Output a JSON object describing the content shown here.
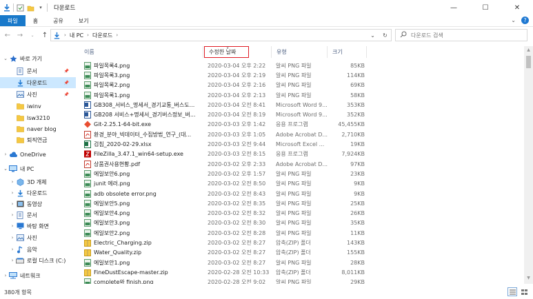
{
  "window": {
    "title": "다운로드",
    "controls": [
      "minimize",
      "maximize",
      "close"
    ]
  },
  "ribbon": {
    "tabs": [
      "파일",
      "홈",
      "공유",
      "보기"
    ]
  },
  "address": {
    "crumbs": [
      "내 PC",
      "다운로드"
    ],
    "search_placeholder": "다운로드 검색"
  },
  "nav": {
    "items": [
      {
        "label": "바로 가기",
        "icon": "star-icon",
        "level": 0,
        "expanded": true
      },
      {
        "label": "문서",
        "icon": "document-icon",
        "level": 1,
        "pinned": true
      },
      {
        "label": "다운로드",
        "icon": "download-icon",
        "level": 1,
        "pinned": true,
        "selected": true
      },
      {
        "label": "사진",
        "icon": "picture-icon",
        "level": 1,
        "pinned": true
      },
      {
        "label": "iwinv",
        "icon": "folder-icon",
        "level": 1
      },
      {
        "label": "lsw3210",
        "icon": "folder-icon",
        "level": 1
      },
      {
        "label": "naver blog",
        "icon": "folder-icon",
        "level": 1
      },
      {
        "label": "퇴직연금",
        "icon": "folder-icon",
        "level": 1
      },
      {
        "label": "OneDrive",
        "icon": "cloud-icon",
        "level": 0
      },
      {
        "label": "내 PC",
        "icon": "pc-icon",
        "level": 0,
        "expanded": true
      },
      {
        "label": "3D 개체",
        "icon": "cube-icon",
        "level": 1
      },
      {
        "label": "다운로드",
        "icon": "download-icon",
        "level": 1
      },
      {
        "label": "동영상",
        "icon": "video-icon",
        "level": 1
      },
      {
        "label": "문서",
        "icon": "document-icon",
        "level": 1
      },
      {
        "label": "바탕 화면",
        "icon": "desktop-icon",
        "level": 1
      },
      {
        "label": "사진",
        "icon": "picture-icon",
        "level": 1
      },
      {
        "label": "음악",
        "icon": "music-icon",
        "level": 1
      },
      {
        "label": "로컬 디스크 (C:)",
        "icon": "disk-icon",
        "level": 1
      },
      {
        "label": "네트워크",
        "icon": "network-icon",
        "level": 0
      }
    ]
  },
  "columns": {
    "name": "이름",
    "date": "수정한 날짜",
    "type": "유형",
    "size": "크기"
  },
  "files": [
    {
      "name": "파일목록4.png",
      "date": "2020-03-04 오후 2:22",
      "type": "알씨 PNG 파일",
      "size": "85KB",
      "icon": "png-icon"
    },
    {
      "name": "파일목록3.png",
      "date": "2020-03-04 오후 2:19",
      "type": "알씨 PNG 파일",
      "size": "114KB",
      "icon": "png-icon"
    },
    {
      "name": "파일목록2.png",
      "date": "2020-03-04 오후 2:16",
      "type": "알씨 PNG 파일",
      "size": "69KB",
      "icon": "png-icon"
    },
    {
      "name": "파일목록1.png",
      "date": "2020-03-04 오후 2:13",
      "type": "알씨 PNG 파일",
      "size": "58KB",
      "icon": "png-icon"
    },
    {
      "name": "GB308_서비스_명세서_경기교통_버스도...",
      "date": "2020-03-04 오전 8:41",
      "type": "Microsoft Word 9...",
      "size": "353KB",
      "icon": "word-icon"
    },
    {
      "name": "GB208 서비스+명세서_경기버스정보_버...",
      "date": "2020-03-04 오전 8:19",
      "type": "Microsoft Word 9...",
      "size": "352KB",
      "icon": "word-icon"
    },
    {
      "name": "Git-2.25.1-64-bit.exe",
      "date": "2020-03-03 오후 1:42",
      "type": "응용 프로그램",
      "size": "45,455KB",
      "icon": "git-icon"
    },
    {
      "name": "환경_분야_빅데이터_수집방법_연구_(대...",
      "date": "2020-03-03 오후 1:05",
      "type": "Adobe Acrobat D...",
      "size": "2,710KB",
      "icon": "pdf-icon"
    },
    {
      "name": "검침_2020-02-29.xlsx",
      "date": "2020-03-03 오전 9:44",
      "type": "Microsoft Excel ...",
      "size": "19KB",
      "icon": "excel-icon"
    },
    {
      "name": "FileZilla_3.47.1_win64-setup.exe",
      "date": "2020-03-03 오전 8:15",
      "type": "응용 프로그램",
      "size": "7,924KB",
      "icon": "filezilla-icon"
    },
    {
      "name": "상품권사용현황.pdf",
      "date": "2020-03-02 오후 2:33",
      "type": "Adobe Acrobat D...",
      "size": "97KB",
      "icon": "pdf-icon"
    },
    {
      "name": "에일보안6.png",
      "date": "2020-03-02 오후 1:57",
      "type": "알씨 PNG 파일",
      "size": "23KB",
      "icon": "png-icon"
    },
    {
      "name": "junit 에러.png",
      "date": "2020-03-02 오전 8:50",
      "type": "알씨 PNG 파일",
      "size": "9KB",
      "icon": "png-icon"
    },
    {
      "name": "adb obsolete error.png",
      "date": "2020-03-02 오전 8:43",
      "type": "알씨 PNG 파일",
      "size": "9KB",
      "icon": "png-icon"
    },
    {
      "name": "에일보안5.png",
      "date": "2020-03-02 오전 8:35",
      "type": "알씨 PNG 파일",
      "size": "25KB",
      "icon": "png-icon"
    },
    {
      "name": "에일보안4.png",
      "date": "2020-03-02 오전 8:32",
      "type": "알씨 PNG 파일",
      "size": "26KB",
      "icon": "png-icon"
    },
    {
      "name": "에일보안3.png",
      "date": "2020-03-02 오전 8:30",
      "type": "알씨 PNG 파일",
      "size": "35KB",
      "icon": "png-icon"
    },
    {
      "name": "에일보안2.png",
      "date": "2020-03-02 오전 8:28",
      "type": "알씨 PNG 파일",
      "size": "11KB",
      "icon": "png-icon"
    },
    {
      "name": "Electric_Charging.zip",
      "date": "2020-03-02 오전 8:27",
      "type": "압축(ZIP) 폴더",
      "size": "143KB",
      "icon": "zip-icon"
    },
    {
      "name": "Water_Quality.zip",
      "date": "2020-03-02 오전 8:27",
      "type": "압축(ZIP) 폴더",
      "size": "155KB",
      "icon": "zip-icon"
    },
    {
      "name": "에일보안1.png",
      "date": "2020-03-02 오전 8:27",
      "type": "알씨 PNG 파일",
      "size": "28KB",
      "icon": "png-icon"
    },
    {
      "name": "FineDustEscape-master.zip",
      "date": "2020-02-28 오전 10:33",
      "type": "압축(ZIP) 폴더",
      "size": "8,011KB",
      "icon": "zip-icon"
    },
    {
      "name": "complete와 finish.png",
      "date": "2020-02-28 오전 9:02",
      "type": "알씨 PNG 파일",
      "size": "29KB",
      "icon": "png-icon"
    }
  ],
  "status": {
    "item_count": "380개 항목"
  }
}
